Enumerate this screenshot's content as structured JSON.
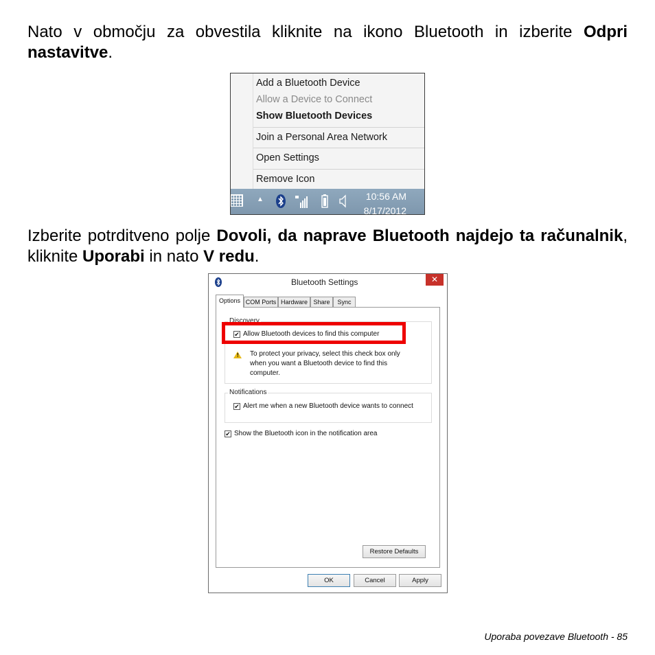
{
  "paragraph1": {
    "text": "Nato v območju za obvestila kliknite na ikono Bluetooth in izberite ",
    "bold": "Odpri nastavitve",
    "end": "."
  },
  "context_menu": {
    "items": [
      {
        "label": "Add a Bluetooth Device",
        "state": "normal"
      },
      {
        "label": "Allow a Device to Connect",
        "state": "disabled"
      },
      {
        "label": "Show Bluetooth Devices",
        "state": "bold"
      },
      {
        "label": "Join a Personal Area Network",
        "state": "normal"
      },
      {
        "label": "Open Settings",
        "state": "normal"
      },
      {
        "label": "Remove Icon",
        "state": "normal"
      }
    ]
  },
  "taskbar": {
    "time": "10:56 AM",
    "date": "8/17/2012",
    "icons": [
      "keyboard-icon",
      "chevron-up-icon",
      "bluetooth-icon",
      "network-signal-icon",
      "battery-icon",
      "speaker-icon"
    ]
  },
  "paragraph2": {
    "t1": "Izberite potrditveno polje ",
    "b1": "Dovoli, da naprave Bluetooth najdejo ta računalnik",
    "t2": ", kliknite ",
    "b2": "Uporabi",
    "t3": " in nato ",
    "b3": "V redu",
    "t4": "."
  },
  "dialog": {
    "title": "Bluetooth Settings",
    "tabs": [
      "Options",
      "COM Ports",
      "Hardware",
      "Share",
      "Sync"
    ],
    "discovery_label": "Discovery",
    "allow_find": {
      "label": "Allow Bluetooth devices to find this computer",
      "checked": true
    },
    "privacy_warning": "To protect your privacy, select this check box only when you want a Bluetooth device to find this computer.",
    "notifications_label": "Notifications",
    "alert_connect": {
      "label": "Alert me when a new Bluetooth device wants to connect",
      "checked": true
    },
    "show_icon": {
      "label": "Show the Bluetooth icon in the notification area",
      "checked": true
    },
    "restore_label": "Restore Defaults",
    "ok_label": "OK",
    "cancel_label": "Cancel",
    "apply_label": "Apply",
    "close_glyph": "✕"
  },
  "colors": {
    "highlight": "#ee0000",
    "taskbar": "#8fa8bd",
    "close_button": "#c7312a",
    "warning": "#e7b916"
  },
  "footer": {
    "text": "Uporaba povezave Bluetooth -  85"
  }
}
